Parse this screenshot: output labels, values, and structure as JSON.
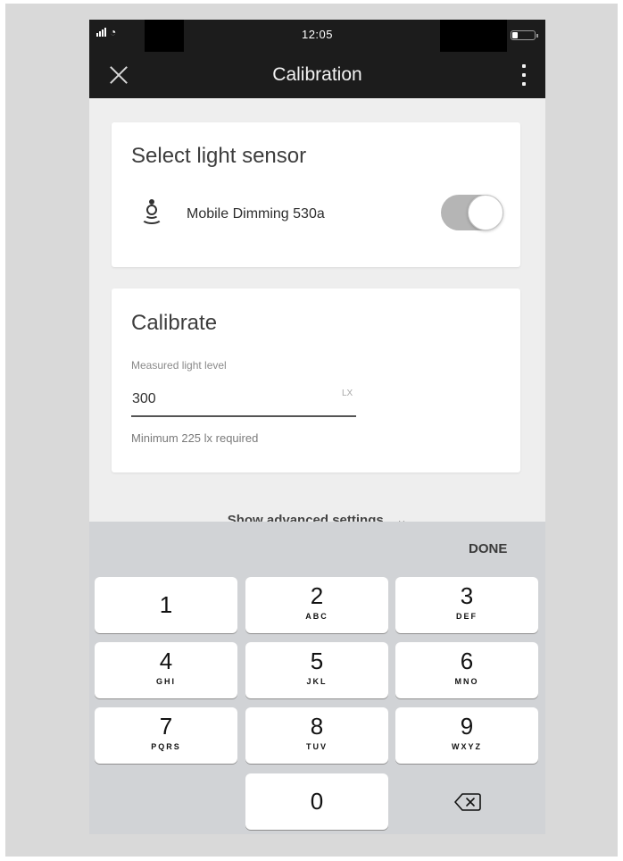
{
  "status_bar": {
    "time": "12:05",
    "signal_icon": "signal-bars-icon",
    "wifi_icon": "wifi-icon",
    "battery_icon": "battery-icon"
  },
  "app_bar": {
    "title": "Calibration",
    "close_icon": "close-icon",
    "menu_icon": "more-vertical-icon"
  },
  "sensor_card": {
    "title": "Select light sensor",
    "sensor_icon": "light-sensor-icon",
    "sensor_name": "Mobile Dimming 530a",
    "toggle_on": true
  },
  "calibrate_card": {
    "title": "Calibrate",
    "field_label": "Measured light level",
    "field_value": "300",
    "field_unit": "LX",
    "helper_text": "Minimum 225 lx required"
  },
  "advanced": {
    "label": "Show advanced settings",
    "icon": "chevron-down-icon"
  },
  "keyboard": {
    "done_label": "DONE",
    "keys": [
      {
        "digit": "1",
        "letters": ""
      },
      {
        "digit": "2",
        "letters": "ABC"
      },
      {
        "digit": "3",
        "letters": "DEF"
      },
      {
        "digit": "4",
        "letters": "GHI"
      },
      {
        "digit": "5",
        "letters": "JKL"
      },
      {
        "digit": "6",
        "letters": "MNO"
      },
      {
        "digit": "7",
        "letters": "PQRS"
      },
      {
        "digit": "8",
        "letters": "TUV"
      },
      {
        "digit": "9",
        "letters": "WXYZ"
      },
      {
        "digit": "0",
        "letters": ""
      }
    ],
    "backspace_icon": "backspace-icon"
  },
  "colors": {
    "app_bar": "#1c1c1c",
    "screen_bg": "#eeeeee",
    "keyboard_bg": "#d1d3d6",
    "toggle_track": "#b5b5b5"
  }
}
